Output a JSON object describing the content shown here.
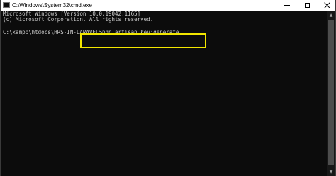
{
  "window": {
    "title": "C:\\Windows\\System32\\cmd.exe",
    "app_icon": "cmd-icon",
    "controls": {
      "minimize_icon": "minimize-icon",
      "maximize_icon": "maximize-icon",
      "close_icon": "close-icon"
    }
  },
  "console": {
    "lines": [
      "Microsoft Windows [Version 10.0.19042.1165]",
      "(c) Microsoft Corporation. All rights reserved.",
      "",
      "C:\\xampp\\htdocs\\HRS-IN-LARAVEL>php artisan key:generate"
    ],
    "highlighted_command": "php artisan key:generate",
    "highlight_color": "#f2e600",
    "text_color": "#cccccc",
    "background_color": "#0c0c0c"
  },
  "scrollbar": {
    "up_icon": "scroll-up-arrow-icon",
    "down_icon": "scroll-down-arrow-icon"
  }
}
